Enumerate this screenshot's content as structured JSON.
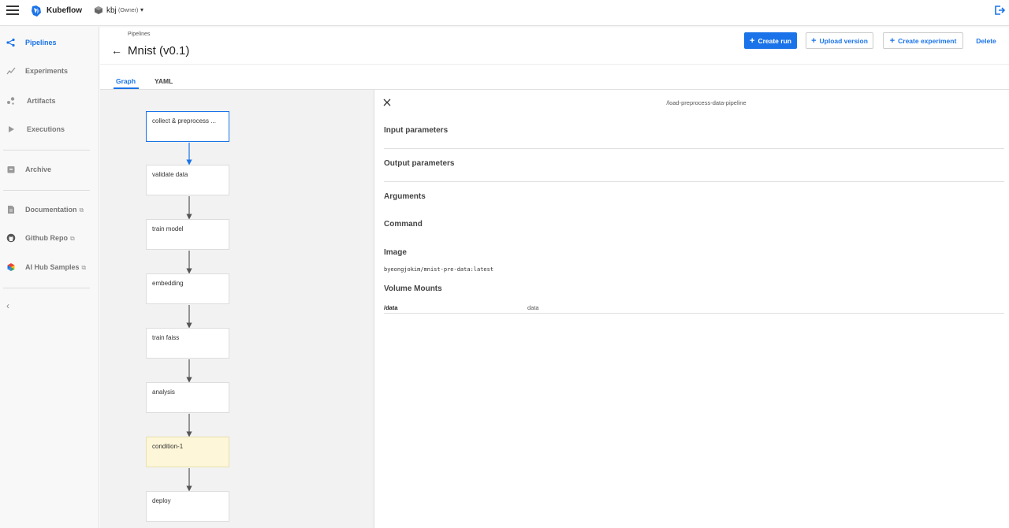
{
  "topbar": {
    "brand": "Kubeflow",
    "namespace": "kbj",
    "namespace_role": "(Owner)",
    "caret": "▾"
  },
  "sidebar": {
    "items": [
      {
        "label": "Pipelines",
        "icon": "pipelines-icon",
        "active": true
      },
      {
        "label": "Experiments",
        "icon": "experiments-icon"
      },
      {
        "label": "Artifacts",
        "icon": "artifacts-icon"
      },
      {
        "label": "Executions",
        "icon": "executions-icon"
      },
      {
        "label": "Archive",
        "icon": "archive-icon"
      },
      {
        "label": "Documentation",
        "icon": "documentation-icon",
        "external": true
      },
      {
        "label": "Github Repo",
        "icon": "github-icon",
        "external": true
      },
      {
        "label": "AI Hub Samples",
        "icon": "ai-hub-icon",
        "external": true
      }
    ],
    "collapse_glyph": "‹"
  },
  "header": {
    "breadcrumb": "Pipelines",
    "back_glyph": "←",
    "title": "Mnist (v0.1)",
    "buttons": {
      "create_run": "Create run",
      "upload_version": "Upload version",
      "create_experiment": "Create experiment",
      "delete": "Delete"
    }
  },
  "tabs": [
    "Graph",
    "YAML"
  ],
  "graph": {
    "nodes": [
      {
        "label": "collect & preprocess ...",
        "selected": true
      },
      {
        "label": "validate data"
      },
      {
        "label": "train model"
      },
      {
        "label": "embedding"
      },
      {
        "label": "train faiss"
      },
      {
        "label": "analysis"
      },
      {
        "label": "condition-1",
        "condition": true
      },
      {
        "label": "deploy"
      }
    ]
  },
  "panel": {
    "title": "/load-preprocess-data-pipeline",
    "sections": {
      "input_parameters": "Input parameters",
      "output_parameters": "Output parameters",
      "arguments": "Arguments",
      "command": "Command",
      "image": "Image",
      "volume_mounts": "Volume Mounts"
    },
    "image_value": "byeongjokim/mnist-pre-data:latest",
    "volume_mounts": [
      {
        "path": "/data",
        "name": "data"
      }
    ]
  },
  "colors": {
    "accent": "#1a73e8",
    "condition_bg": "#fdf6d8",
    "canvas_bg": "#f2f2f2"
  }
}
